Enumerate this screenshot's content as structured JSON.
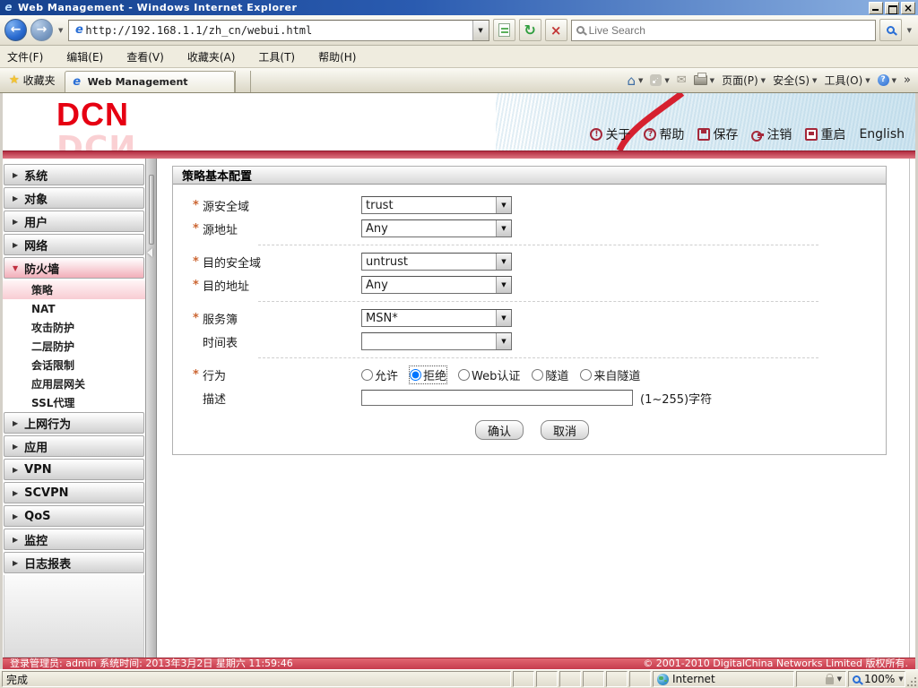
{
  "window": {
    "title": "Web Management - Windows Internet Explorer"
  },
  "address_bar": {
    "url": "http://192.168.1.1/zh_cn/webui.html",
    "search_placeholder": "Live Search"
  },
  "menu_bar": {
    "items": [
      {
        "label": "文件(F)"
      },
      {
        "label": "编辑(E)"
      },
      {
        "label": "查看(V)"
      },
      {
        "label": "收藏夹(A)"
      },
      {
        "label": "工具(T)"
      },
      {
        "label": "帮助(H)"
      }
    ]
  },
  "favorites_bar": {
    "favorites_label": "收藏夹",
    "tab_title": "Web Management",
    "commands": [
      {
        "label": "页面(P)"
      },
      {
        "label": "安全(S)"
      },
      {
        "label": "工具(O)"
      }
    ]
  },
  "banner": {
    "logo": "DCN",
    "links": [
      {
        "label": "关于"
      },
      {
        "label": "帮助"
      },
      {
        "label": "保存"
      },
      {
        "label": "注销"
      },
      {
        "label": "重启"
      },
      {
        "label": "English"
      }
    ]
  },
  "sidebar": {
    "items": [
      {
        "label": "系统"
      },
      {
        "label": "对象"
      },
      {
        "label": "用户"
      },
      {
        "label": "网络"
      },
      {
        "label": "防火墙",
        "expanded": true
      },
      {
        "label": "上网行为"
      },
      {
        "label": "应用"
      },
      {
        "label": "VPN"
      },
      {
        "label": "SCVPN"
      },
      {
        "label": "QoS"
      },
      {
        "label": "监控"
      },
      {
        "label": "日志报表"
      }
    ],
    "submenu": [
      {
        "label": "策略",
        "selected": true
      },
      {
        "label": "NAT"
      },
      {
        "label": "攻击防护"
      },
      {
        "label": "二层防护"
      },
      {
        "label": "会话限制"
      },
      {
        "label": "应用层网关"
      },
      {
        "label": "SSL代理"
      }
    ]
  },
  "form": {
    "title": "策略基本配置",
    "fields": {
      "src_zone": {
        "required": "*",
        "label": "源安全域",
        "value": "trust"
      },
      "src_addr": {
        "required": "*",
        "label": "源地址",
        "value": "Any"
      },
      "dst_zone": {
        "required": "*",
        "label": "目的安全域",
        "value": "untrust"
      },
      "dst_addr": {
        "required": "*",
        "label": "目的地址",
        "value": "Any"
      },
      "service": {
        "required": "*",
        "label": "服务簿",
        "value": "MSN*"
      },
      "schedule": {
        "label": "时间表",
        "value": ""
      },
      "action": {
        "required": "*",
        "label": "行为",
        "options": [
          {
            "label": "允许"
          },
          {
            "label": "拒绝",
            "checked": true
          },
          {
            "label": "Web认证"
          },
          {
            "label": "隧道"
          },
          {
            "label": "来自隧道"
          }
        ]
      },
      "description": {
        "label": "描述",
        "value": "",
        "hint": "(1~255)字符"
      }
    },
    "buttons": {
      "confirm": "确认",
      "cancel": "取消"
    }
  },
  "footer": {
    "left": "登录管理员: admin 系统时间: 2013年3月2日 星期六 11:59:46",
    "right": "© 2001-2010 DigitalChina Networks Limited 版权所有."
  },
  "status_bar": {
    "status": "完成",
    "zone": "Internet",
    "zoom": "100%"
  },
  "colors": {
    "brand_red": "#e60012",
    "footer_red": "#c63c4d",
    "required_mark": "#cc6633"
  }
}
